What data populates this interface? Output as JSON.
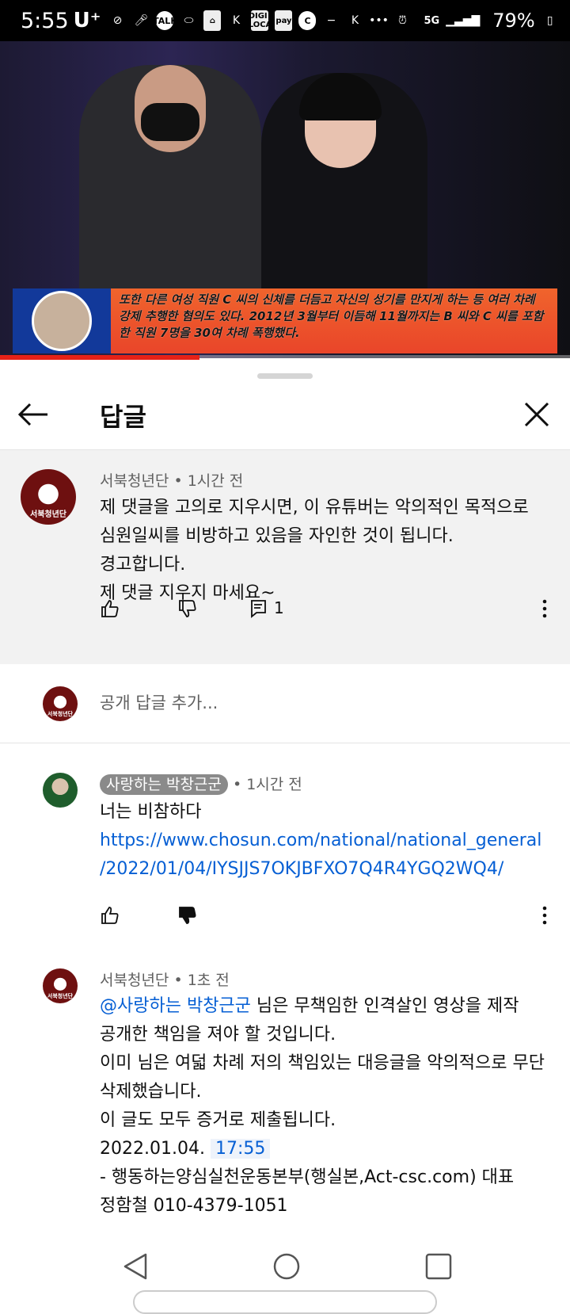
{
  "status_bar": {
    "time": "5:55",
    "carrier": "U⁺",
    "icons": [
      "TALK",
      "DIGI LOCA",
      "pay",
      "C"
    ],
    "network": "5G",
    "battery": "79%"
  },
  "video": {
    "overlay_text": "또한 다른 여성 직원 C 씨의 신체를 더듬고 자신의 성기를 만지게 하는 등 여러 차례 강제 추행한 혐의도 있다. 2012년 3월부터 이듬해 11월까지는 B 씨와 C 씨를 포함한 직원 7명을 30여 차례 폭행했다.",
    "progress_percent": 35
  },
  "header": {
    "title": "답글"
  },
  "parent_comment": {
    "author": "서북청년단",
    "time": "1시간 전",
    "lines": [
      "제 댓글을 고의로 지우시면, 이 유튜버는 악의적인 목적으로",
      "심원일씨를 비방하고 있음을 자인한 것이 됩니다.",
      "경고합니다.",
      "제 댓글 지우지 마세요~"
    ],
    "reply_count": "1",
    "logo_text": "서북청년단"
  },
  "add_reply": {
    "placeholder": "공개 답글 추가...",
    "logo_text": "서북청년단"
  },
  "reply1": {
    "author": "사랑하는 박창근군",
    "time": "1시간 전",
    "text": "너는 비참하다",
    "link_line1": "https://www.chosun.com/national/national_general",
    "link_line2": "/2022/01/04/IYSJJS7OKJBFXO7Q4R4YGQ2WQ4/"
  },
  "reply2": {
    "author": "서북청년단",
    "time": "1초 전",
    "mention": "@사랑하는 박창근군",
    "line1_rest": "님은 무책임한 인격살인 영상을 제작",
    "lines": [
      "공개한 책임을 져야 할 것입니다.",
      "이미 님은 여덟 차례 저의 책임있는 대응글을 악의적으로 무단",
      "삭제했습니다.",
      "이 글도 모두 증거로 제출됩니다."
    ],
    "date": "2022.01.04.",
    "timestamp": "17:55",
    "sign1": "- 행동하는양심실천운동본부(행실본,Act-csc.com) 대표",
    "sign2": "정함철 010-4379-1051",
    "logo_text": "서북청년단"
  },
  "colors": {
    "link": "#065fd4",
    "progress": "#e62117",
    "logo": "#6e1010"
  }
}
